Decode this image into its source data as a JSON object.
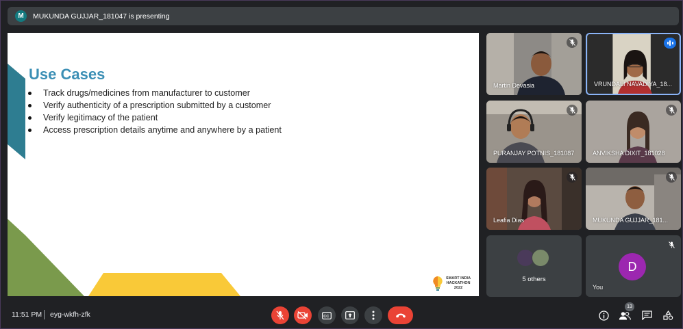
{
  "presenting": {
    "avatar_letter": "M",
    "text": "MUKUNDA GUJJAR_181047 is presenting"
  },
  "slide": {
    "title": "Use Cases",
    "bullets": [
      "Track drugs/medicines from manufacturer to customer",
      "Verify authenticity of a prescription submitted by a customer",
      "Verify legitimacy of the patient",
      "Access prescription details anytime and anywhere by a patient"
    ],
    "logo": {
      "line1": "SMART INDIA",
      "line2": "HACKATHON",
      "line3": "2022"
    },
    "colors": {
      "title": "#3b8fb5",
      "teal": "#2e7d91",
      "green": "#7a9a4c",
      "yellow": "#f9c938"
    }
  },
  "participants": [
    {
      "name": "Martin Devasia",
      "muted": true,
      "speaking": false
    },
    {
      "name": "VRUNDALI NAVADIYA_18...",
      "muted": false,
      "speaking": true
    },
    {
      "name": "PURANJAY POTNIS_181087",
      "muted": true,
      "speaking": false
    },
    {
      "name": "ANVIKSHA DIXIT_181028",
      "muted": true,
      "speaking": false
    },
    {
      "name": "Leafia Dias",
      "muted": true,
      "speaking": false
    },
    {
      "name": "MUKUNDA GUJJAR_181...",
      "muted": true,
      "speaking": false
    }
  ],
  "others": {
    "label": "5 others"
  },
  "you": {
    "letter": "D",
    "name": "You",
    "avatar_color": "#9c27b0"
  },
  "bottom": {
    "time": "11:51 PM",
    "meeting_code": "eyg-wkfh-zfk",
    "people_count": "13"
  }
}
